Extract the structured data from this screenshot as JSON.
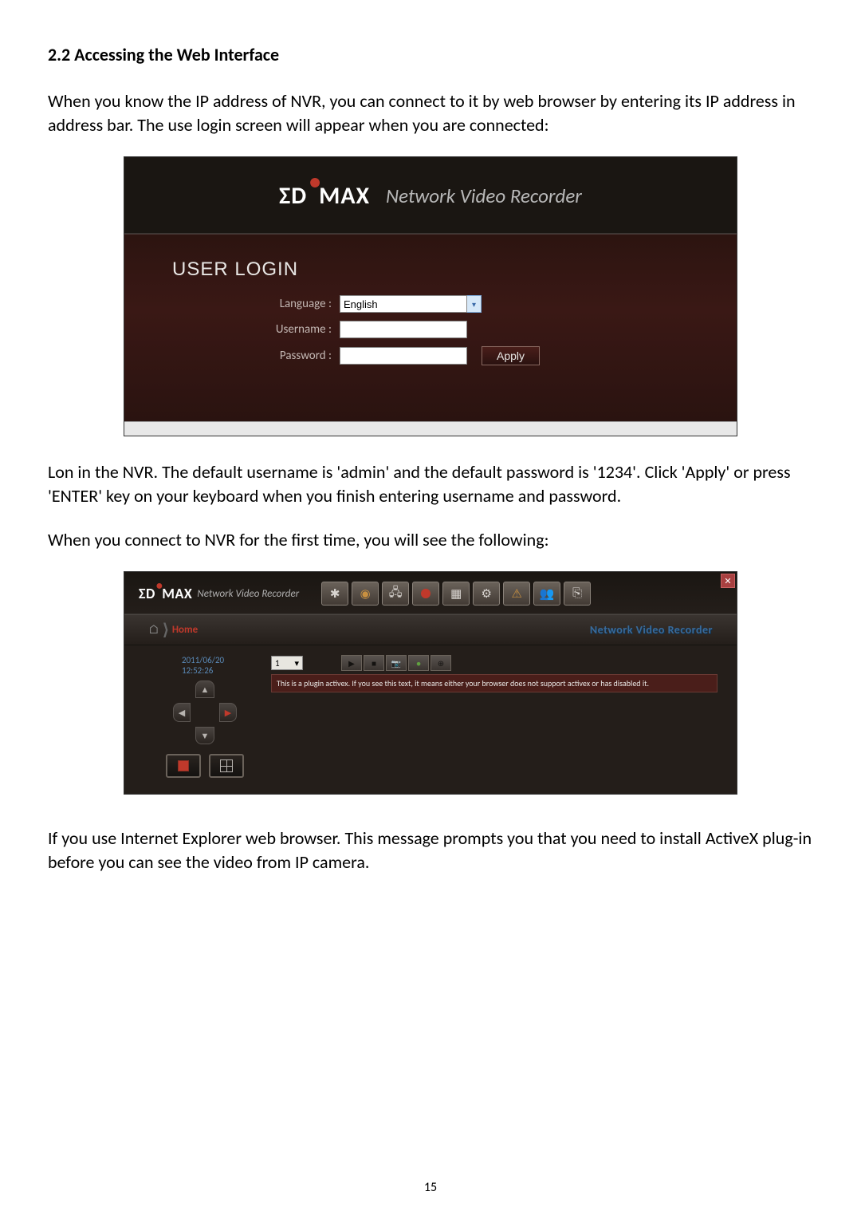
{
  "heading": "2.2 Accessing the Web Interface",
  "para1": "When you know the IP address of NVR, you can connect to it by web browser by entering its IP address in address bar. The use login screen will appear when you are connected:",
  "para2": "Lon in the NVR. The default username is 'admin' and the default password is '1234'. Click 'Apply' or press 'ENTER' key on your keyboard when you finish entering username and password.",
  "para3": "When you connect to NVR for the first time, you will see the following:",
  "para4": "If you use Internet Explorer web browser. This message prompts you that you need to install ActiveX plug-in before you can see the video from IP camera.",
  "page_number": "15",
  "login": {
    "brand_pre": "ΣD",
    "brand_post": "MAX",
    "product_title": "Network Video Recorder",
    "panel_title": "USER LOGIN",
    "language_label": "Language :",
    "language_value": "English",
    "username_label": "Username :",
    "username_value": "",
    "password_label": "Password :",
    "password_value": "",
    "apply_label": "Apply"
  },
  "nvr": {
    "brand_pre": "ΣD",
    "brand_post": "MAX",
    "product_title": "Network Video Recorder",
    "breadcrumb_home": "Home",
    "breadcrumb_right": "Network Video Recorder",
    "timestamp": "2011/06/20 12:52:26",
    "channel_value": "1",
    "plugin_message": "This is a plugin activex. If you see this text, it means either your browser does not support activex or has disabled it."
  }
}
